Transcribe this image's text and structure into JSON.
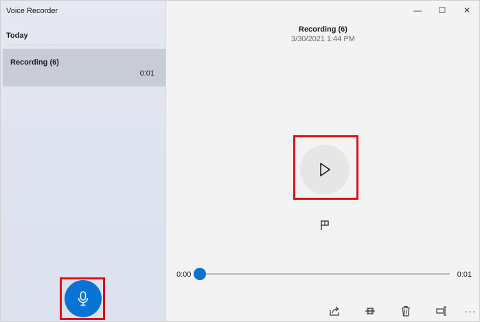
{
  "app": {
    "title": "Voice Recorder"
  },
  "sidebar": {
    "section": "Today",
    "items": [
      {
        "name": "Recording (6)",
        "duration": "0:01"
      }
    ]
  },
  "window_controls": {
    "minimize": "—",
    "maximize": "☐",
    "close": "✕"
  },
  "player": {
    "title": "Recording (6)",
    "date": "3/30/2021 1:44 PM",
    "time_start": "0:00",
    "time_end": "0:01",
    "progress": 0
  },
  "bottom_bar": {
    "more": "···"
  },
  "colors": {
    "accent": "#0a74d4",
    "highlight": "#e01010"
  }
}
